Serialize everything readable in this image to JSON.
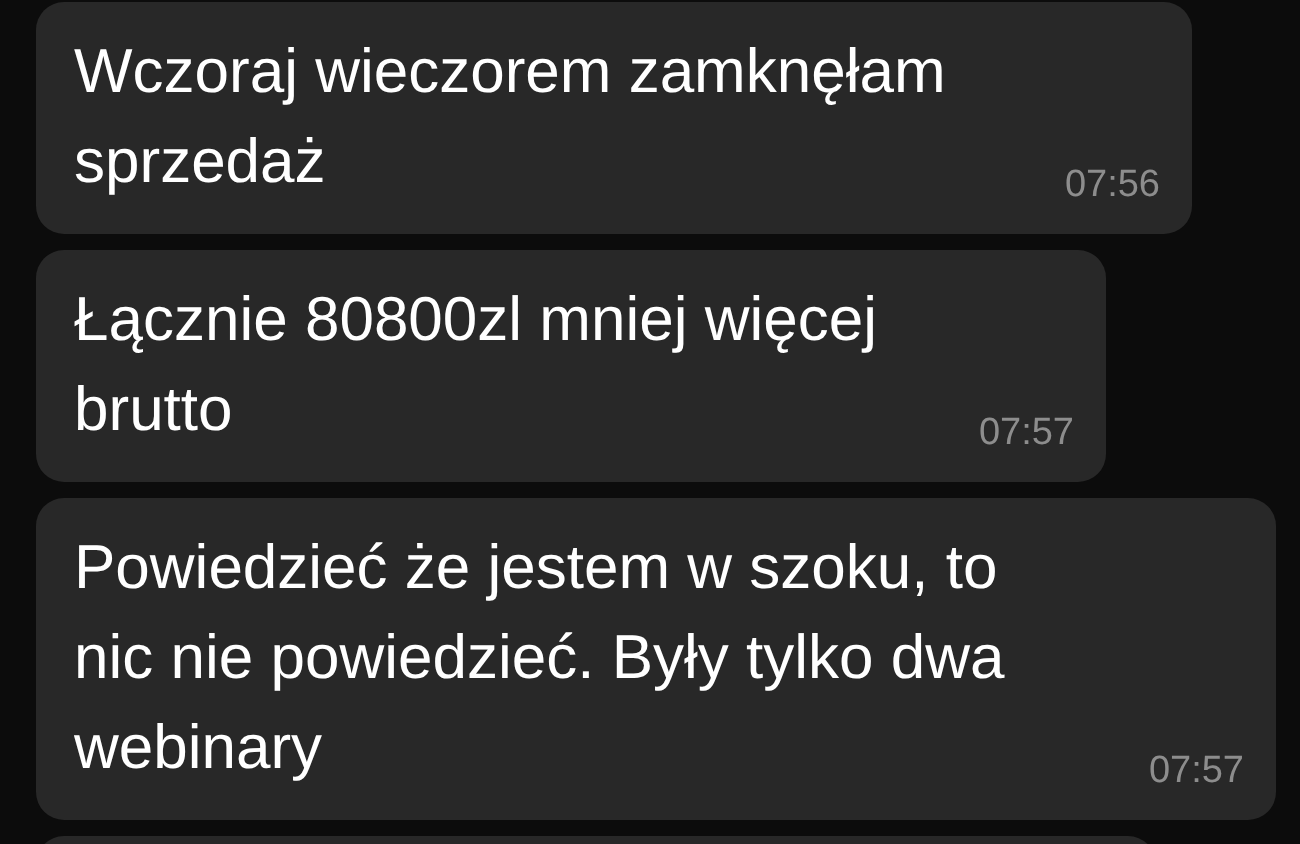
{
  "messages": [
    {
      "text": "Wczoraj wieczorem zamknęłam sprzedaż",
      "time": "07:56"
    },
    {
      "text": "Łącznie 80800zl mniej więcej brutto",
      "time": "07:57"
    },
    {
      "text": "Powiedzieć że jestem w szoku, to nic nie powiedzieć. Były tylko dwa webinary",
      "time": "07:57"
    }
  ]
}
